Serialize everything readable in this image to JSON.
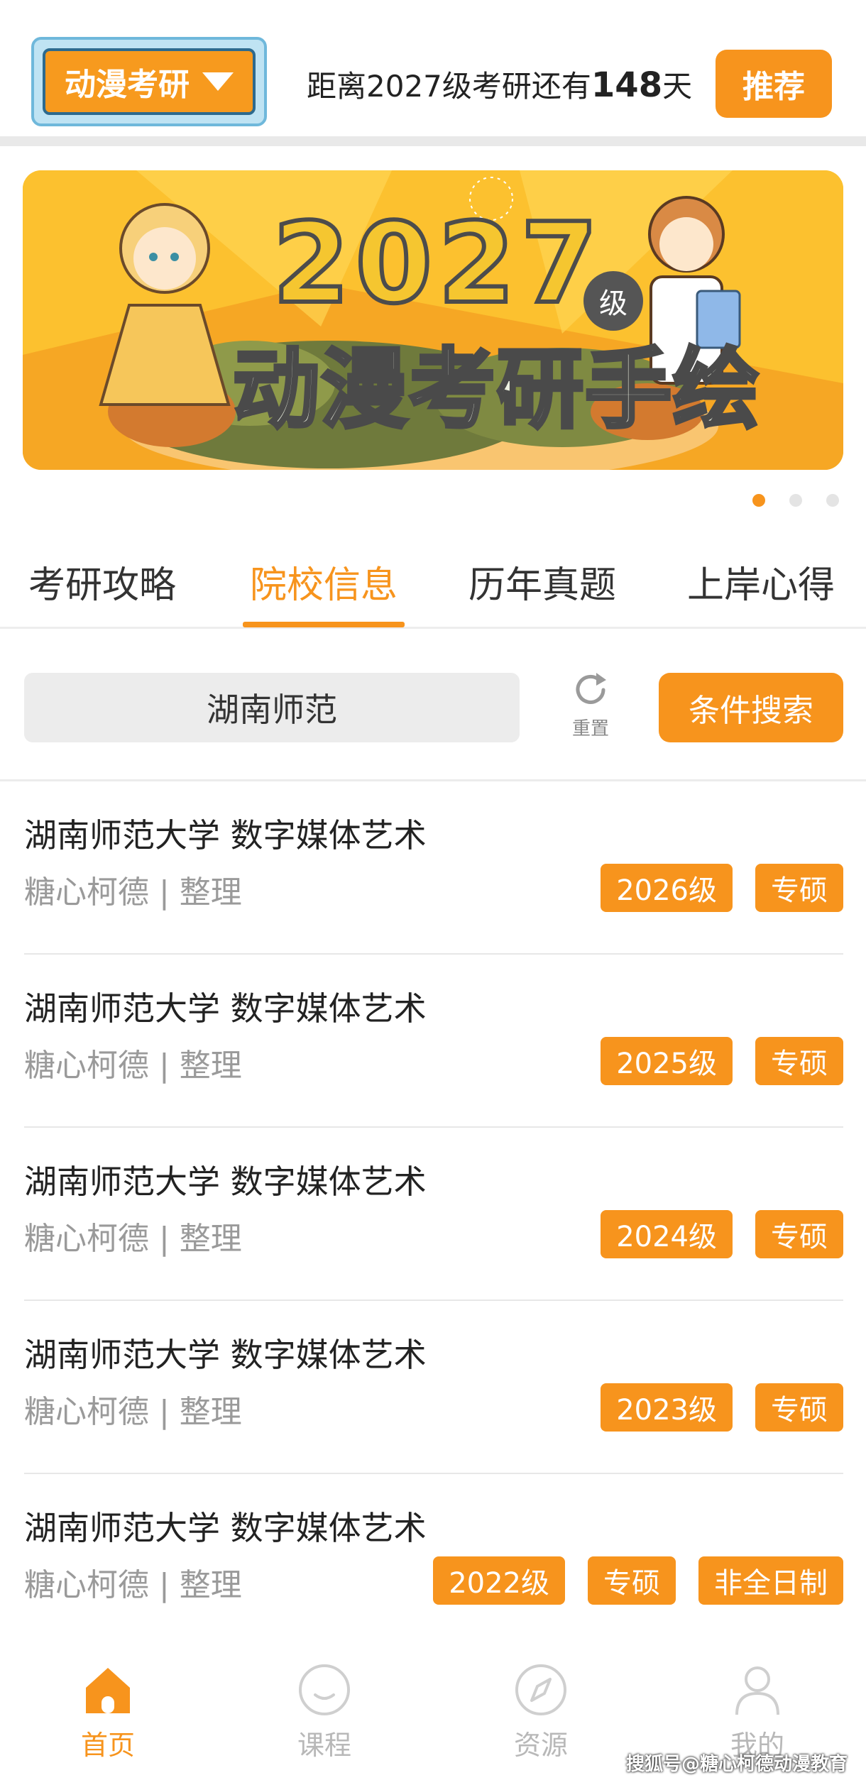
{
  "header": {
    "major_picker_label": "动漫考研",
    "countdown_prefix": "距离2027级考研还有",
    "countdown_days": "148",
    "countdown_suffix": "天",
    "recommend_label": "推荐"
  },
  "banner": {
    "year": "2027",
    "grade": "级",
    "title": "动漫考研手绘",
    "slide_count": 3,
    "active_slide": 1
  },
  "tabs": [
    {
      "label": "考研攻略",
      "active": false
    },
    {
      "label": "院校信息",
      "active": true
    },
    {
      "label": "历年真题",
      "active": false
    },
    {
      "label": "上岸心得",
      "active": false
    }
  ],
  "search": {
    "value": "湖南师范",
    "reset_label": "重置",
    "filter_button": "条件搜索"
  },
  "list": [
    {
      "title": "湖南师范大学 数字媒体艺术",
      "meta": "糖心柯德 | 整理",
      "tags": [
        "2026级",
        "专硕"
      ]
    },
    {
      "title": "湖南师范大学 数字媒体艺术",
      "meta": "糖心柯德 | 整理",
      "tags": [
        "2025级",
        "专硕"
      ]
    },
    {
      "title": "湖南师范大学 数字媒体艺术",
      "meta": "糖心柯德 | 整理",
      "tags": [
        "2024级",
        "专硕"
      ]
    },
    {
      "title": "湖南师范大学 数字媒体艺术",
      "meta": "糖心柯德 | 整理",
      "tags": [
        "2023级",
        "专硕"
      ]
    },
    {
      "title": "湖南师范大学  数字媒体艺术",
      "meta": "糖心柯德 | 整理",
      "tags": [
        "2022级",
        "专硕",
        "非全日制"
      ]
    }
  ],
  "bottom_nav": [
    {
      "label": "首页",
      "icon": "home-icon",
      "active": true
    },
    {
      "label": "课程",
      "icon": "smile-icon",
      "active": false
    },
    {
      "label": "资源",
      "icon": "compass-icon",
      "active": false
    },
    {
      "label": "我的",
      "icon": "user-icon",
      "active": false
    }
  ],
  "watermark": "搜狐号@糖心柯德动漫教育",
  "colors": {
    "accent": "#f7941d",
    "banner_bg": "#fcc12f",
    "muted_text": "#9a9a9a"
  }
}
